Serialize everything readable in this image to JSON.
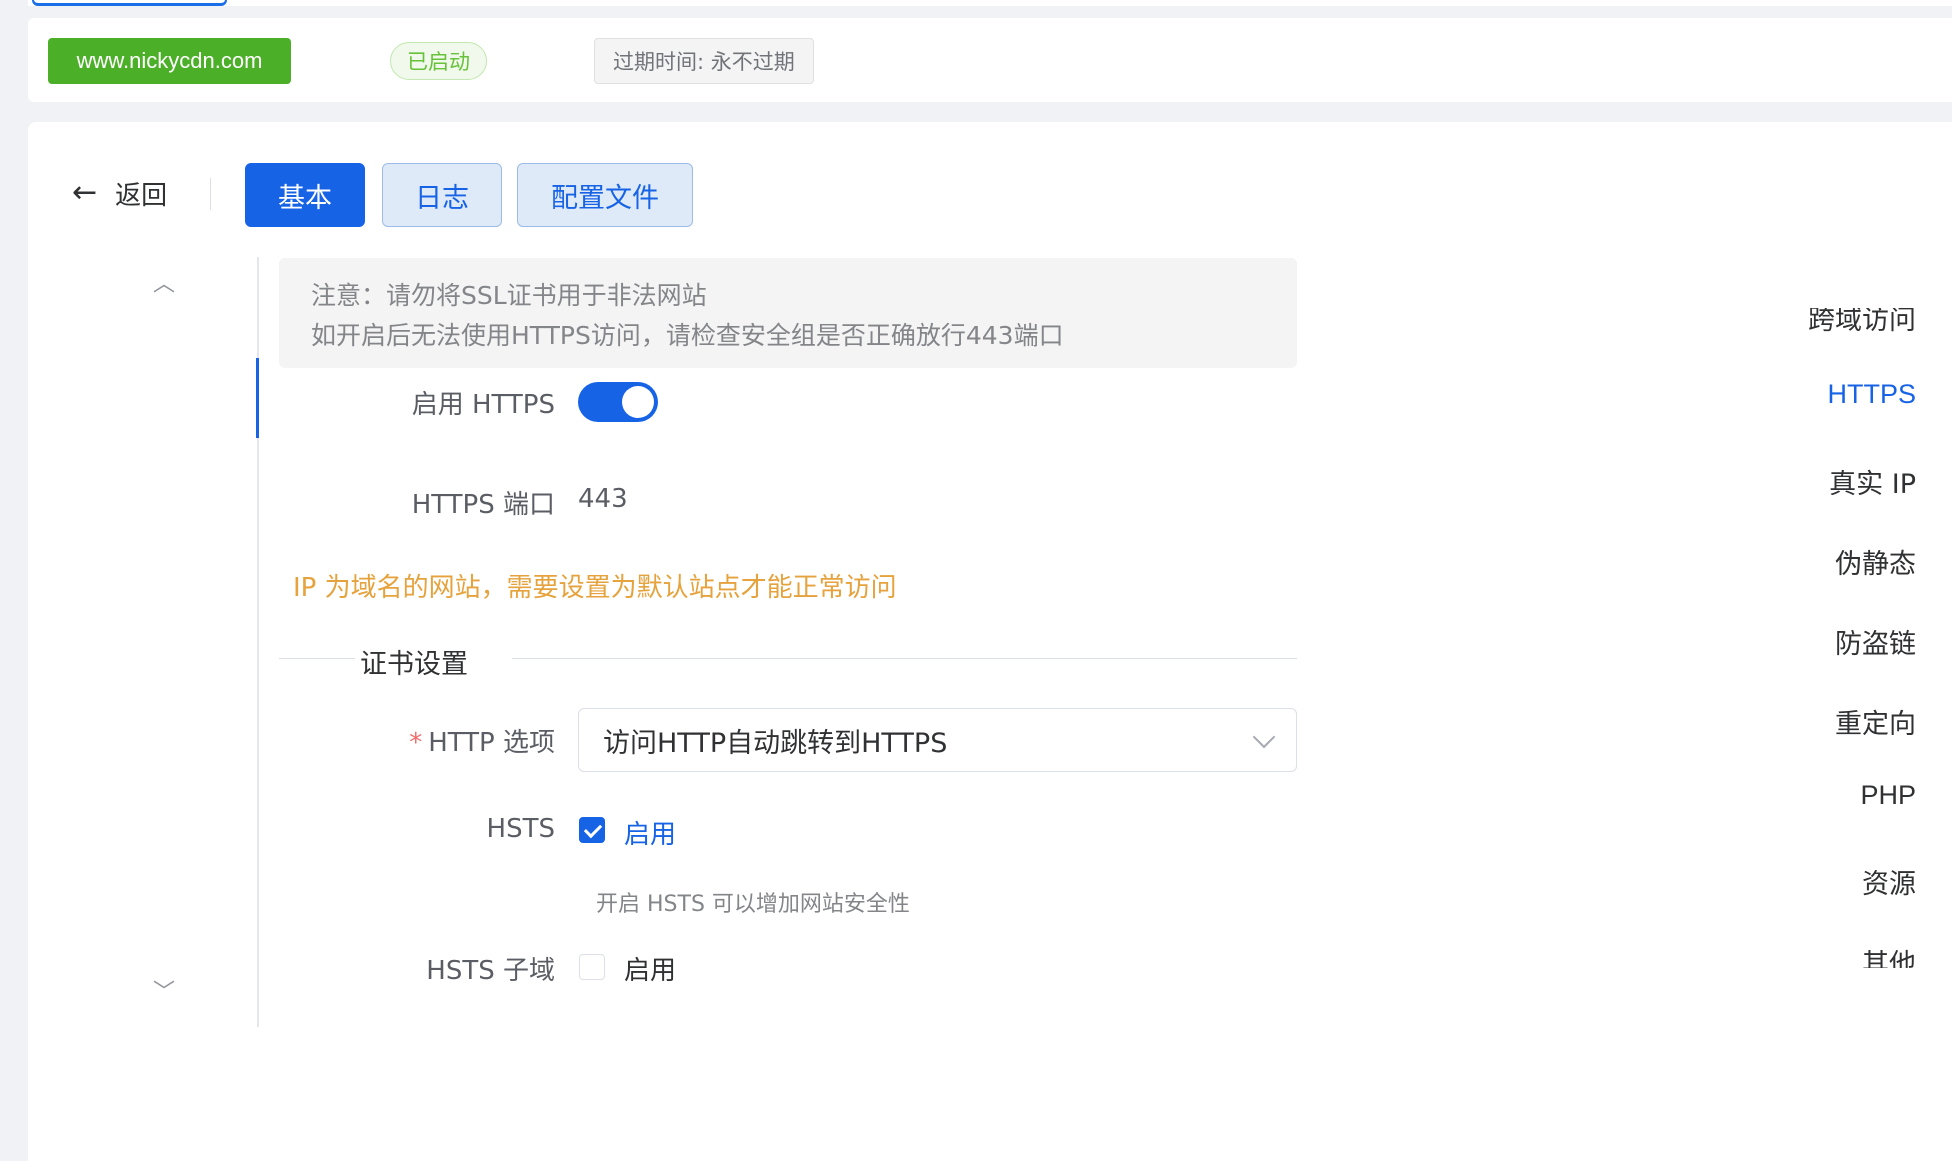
{
  "header": {
    "domain": "www.nickycdn.com",
    "status": "已启动",
    "expire": "过期时间: 永不过期"
  },
  "toolbar": {
    "back_label": "返回",
    "back_icon": "←",
    "tabs": [
      {
        "label": "基本",
        "active": true
      },
      {
        "label": "日志",
        "active": false
      },
      {
        "label": "配置文件",
        "active": false
      }
    ]
  },
  "sidebar": {
    "up_icon": "^",
    "down_icon": "v",
    "items": [
      {
        "label": "跨域访问"
      },
      {
        "label": "HTTPS",
        "active": true
      },
      {
        "label": "真实 IP"
      },
      {
        "label": "伪静态"
      },
      {
        "label": "防盗链"
      },
      {
        "label": "重定向"
      },
      {
        "label": "PHP"
      },
      {
        "label": "资源"
      },
      {
        "label": "其他"
      }
    ]
  },
  "notice": {
    "line1": "注意：请勿将SSL证书用于非法网站",
    "line2": "如开启后无法使用HTTPS访问，请检查安全组是否正确放行443端口"
  },
  "form": {
    "enable_https_label": "启用 HTTPS",
    "enable_https_on": true,
    "https_port_label": "HTTPS 端口",
    "https_port_value": "443",
    "warning": "IP 为域名的网站，需要设置为默认站点才能正常访问",
    "cert_section_title": "证书设置",
    "http_option_required": "*",
    "http_option_label": "HTTP 选项",
    "http_option_value": "访问HTTP自动跳转到HTTPS",
    "hsts_label": "HSTS",
    "hsts_checked": true,
    "hsts_check_label": "启用",
    "hsts_hint": "开启 HSTS 可以增加网站安全性",
    "hsts_sub_label": "HSTS 子域",
    "hsts_sub_checked": false,
    "hsts_sub_check_label": "启用"
  },
  "colors": {
    "primary": "#1763e6",
    "success": "#4caf28",
    "warning": "#e6a23c"
  }
}
